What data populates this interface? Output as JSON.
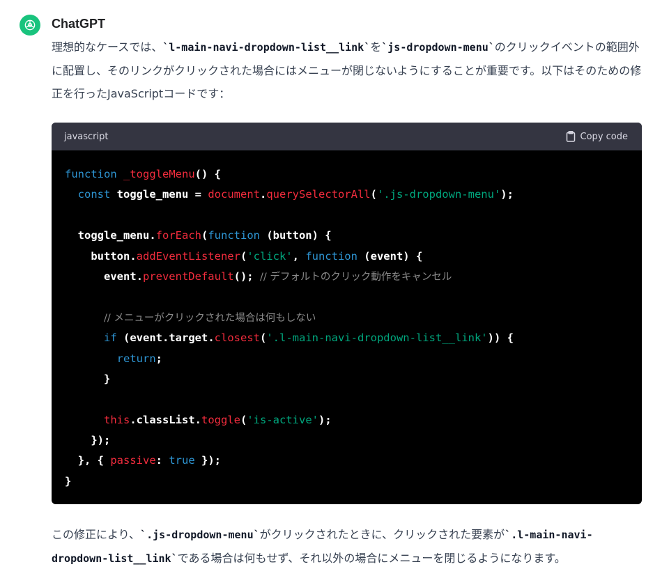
{
  "author": "ChatGPT",
  "avatar_color": "#19c37d",
  "intro": {
    "t1": "理想的なケースでは、",
    "c1": "`l-main-navi-dropdown-list__link`",
    "t2": "を",
    "c2": "`js-dropdown-menu`",
    "t3": "のクリックイベントの範囲外に配置し、そのリンクがクリックされた場合にはメニューが閉じないようにすることが重要です。以下はそのための修正を行ったJavaScriptコードです："
  },
  "code_block": {
    "language": "javascript",
    "copy_label": "Copy code",
    "lines": [
      [
        [
          "kw",
          "function"
        ],
        [
          "pl",
          " "
        ],
        [
          "fn",
          "_toggleMenu"
        ],
        [
          "pl",
          "() {"
        ]
      ],
      [
        [
          "pl",
          "  "
        ],
        [
          "kw",
          "const"
        ],
        [
          "pl",
          " toggle_menu = "
        ],
        [
          "fn",
          "document"
        ],
        [
          "pl",
          "."
        ],
        [
          "fn",
          "querySelectorAll"
        ],
        [
          "pl",
          "("
        ],
        [
          "str",
          "'.js-dropdown-menu'"
        ],
        [
          "pl",
          ");"
        ]
      ],
      [],
      [
        [
          "pl",
          "  toggle_menu."
        ],
        [
          "fn",
          "forEach"
        ],
        [
          "pl",
          "("
        ],
        [
          "kw",
          "function"
        ],
        [
          "pl",
          " (button) {"
        ]
      ],
      [
        [
          "pl",
          "    button."
        ],
        [
          "fn",
          "addEventListener"
        ],
        [
          "pl",
          "("
        ],
        [
          "str",
          "'click'"
        ],
        [
          "pl",
          ", "
        ],
        [
          "kw",
          "function"
        ],
        [
          "pl",
          " (event) {"
        ]
      ],
      [
        [
          "pl",
          "      event."
        ],
        [
          "fn",
          "preventDefault"
        ],
        [
          "pl",
          "(); "
        ],
        [
          "cm",
          "// デフォルトのクリック動作をキャンセル"
        ]
      ],
      [],
      [
        [
          "pl",
          "      "
        ],
        [
          "cm",
          "// メニューがクリックされた場合は何もしない"
        ]
      ],
      [
        [
          "pl",
          "      "
        ],
        [
          "kw",
          "if"
        ],
        [
          "pl",
          " (event.target."
        ],
        [
          "fn",
          "closest"
        ],
        [
          "pl",
          "("
        ],
        [
          "str",
          "'.l-main-navi-dropdown-list__link'"
        ],
        [
          "pl",
          ")) {"
        ]
      ],
      [
        [
          "pl",
          "        "
        ],
        [
          "kw",
          "return"
        ],
        [
          "pl",
          ";"
        ]
      ],
      [
        [
          "pl",
          "      }"
        ]
      ],
      [],
      [
        [
          "pl",
          "      "
        ],
        [
          "fn",
          "this"
        ],
        [
          "pl",
          ".classList."
        ],
        [
          "fn",
          "toggle"
        ],
        [
          "pl",
          "("
        ],
        [
          "str",
          "'is-active'"
        ],
        [
          "pl",
          ");"
        ]
      ],
      [
        [
          "pl",
          "    });"
        ]
      ],
      [
        [
          "pl",
          "  }, { "
        ],
        [
          "fn",
          "passive"
        ],
        [
          "pl",
          ": "
        ],
        [
          "kw",
          "true"
        ],
        [
          "pl",
          " });"
        ]
      ],
      [
        [
          "pl",
          "}"
        ]
      ]
    ]
  },
  "outro": {
    "t1": "この修正により、",
    "c1": "`.js-dropdown-menu`",
    "t2": "がクリックされたときに、クリックされた要素が",
    "c2": "`.l-main-navi-dropdown-list__link`",
    "t3": "である場合は何もせず、それ以外の場合にメニューを閉じるようになります。"
  }
}
